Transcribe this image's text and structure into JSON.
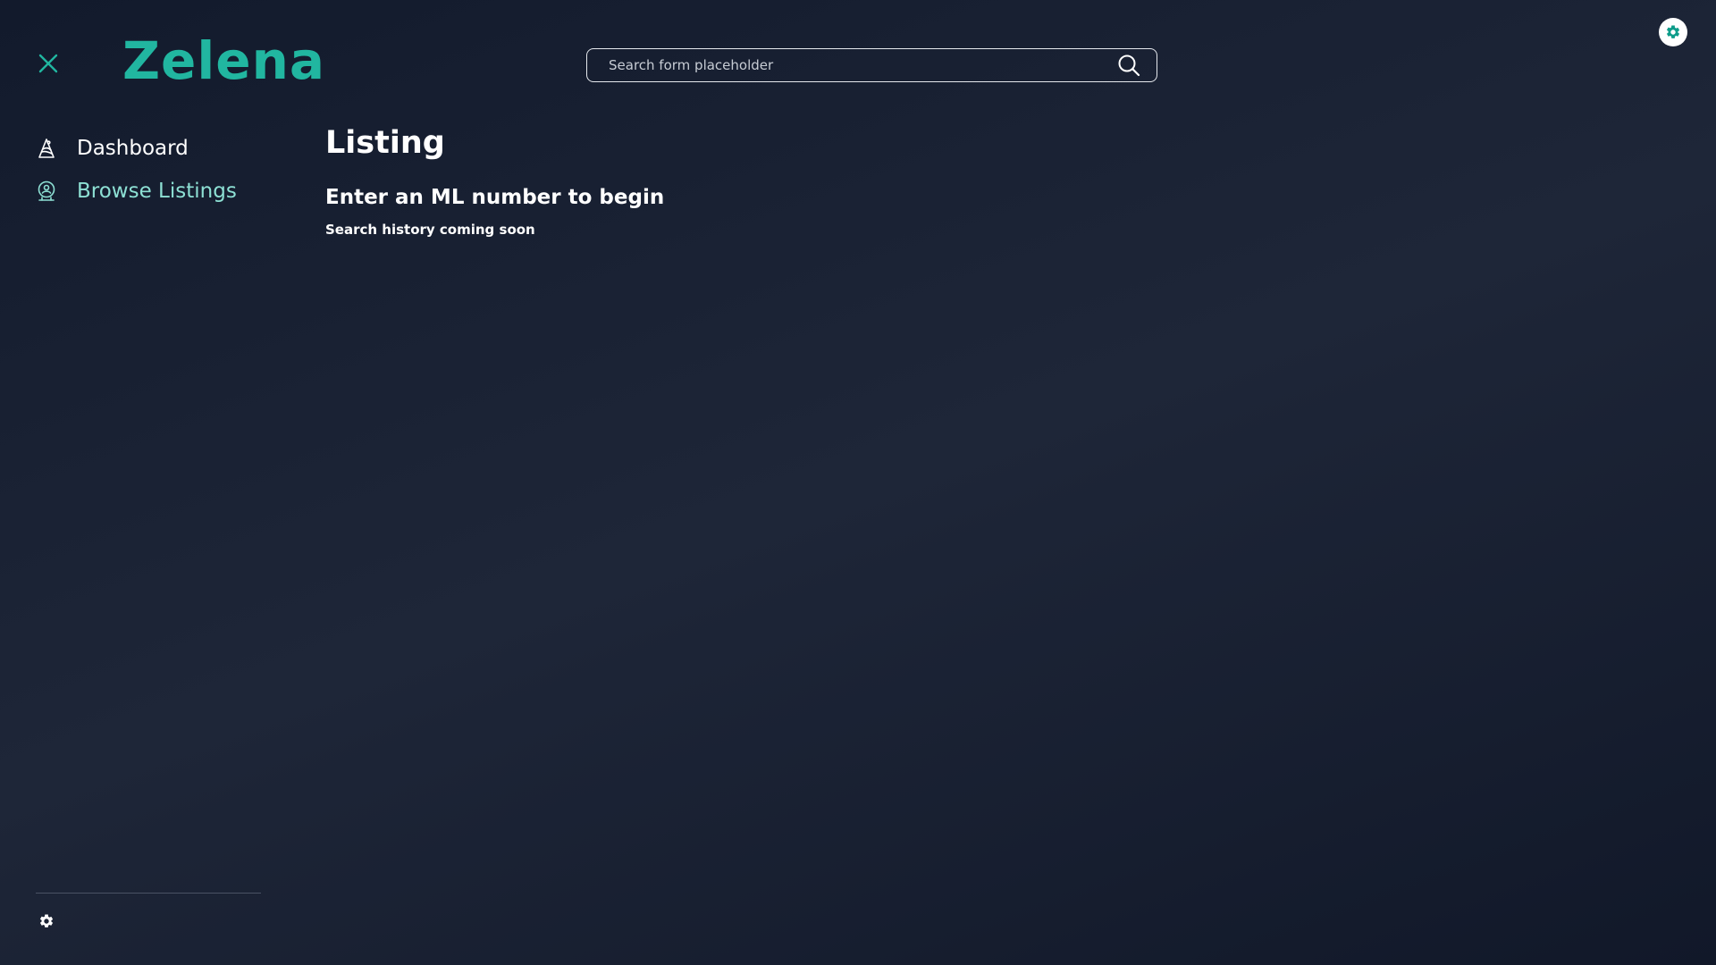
{
  "app": {
    "logo_text": "Zelena",
    "brand_color": "#21b6a0",
    "accent_active_color": "#8de0d4"
  },
  "header": {
    "close_icon": "close-icon",
    "search": {
      "placeholder": "Search form placeholder",
      "value": "",
      "icon": "search-icon"
    },
    "theme_toggle_icon": "gear-icon"
  },
  "sidebar": {
    "items": [
      {
        "label": "Dashboard",
        "icon": "rocket-icon",
        "active": false
      },
      {
        "label": "Browse Listings",
        "icon": "search-user-icon",
        "active": true
      }
    ],
    "settings_icon": "gear-icon"
  },
  "main": {
    "title": "Listing",
    "subtitle": "Enter an ML number to begin",
    "note": "Search history coming soon"
  }
}
